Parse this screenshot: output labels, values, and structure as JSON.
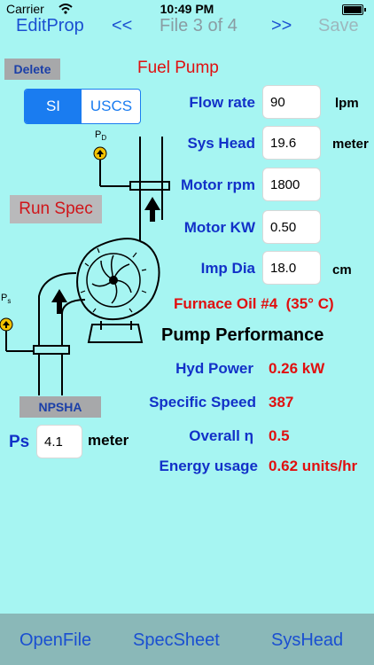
{
  "status": {
    "carrier": "Carrier",
    "time": "10:49 PM"
  },
  "nav": {
    "left": "EditProp",
    "prev": "<<",
    "title": "File 3 of 4",
    "next": ">>",
    "right": "Save"
  },
  "delete_label": "Delete",
  "pump_title": "Fuel Pump",
  "units": {
    "si": "SI",
    "uscs": "USCS"
  },
  "run_spec_label": "Run Spec",
  "npsha_label": "NPSHA",
  "diagram": {
    "pd_label": "P",
    "pd_sub": "D",
    "ps_label": "P",
    "ps_sub": "s"
  },
  "inputs": [
    {
      "label": "Flow rate",
      "value": "90",
      "unit": "lpm"
    },
    {
      "label": "Sys Head",
      "value": "19.6",
      "unit": "meter"
    },
    {
      "label": "Motor rpm",
      "value": "1800",
      "unit": ""
    },
    {
      "label": "Motor KW",
      "value": "0.50",
      "unit": ""
    },
    {
      "label": "Imp Dia",
      "value": "18.0",
      "unit": "cm"
    }
  ],
  "fluid": "Furnace Oil #4  (35° C)",
  "ps": {
    "label": "Ps",
    "value": "4.1",
    "unit": "meter"
  },
  "performance": {
    "heading": "Pump Performance",
    "rows": [
      {
        "label": "Hyd Power",
        "value": "0.26 kW"
      },
      {
        "label": "Specific Speed",
        "value": "387"
      },
      {
        "label": "Overall η",
        "value": "0.5"
      },
      {
        "label": "Energy usage",
        "value": "0.62 units/hr"
      }
    ]
  },
  "toolbar": {
    "open": "OpenFile",
    "spec": "SpecSheet",
    "syshead": "SysHead"
  }
}
